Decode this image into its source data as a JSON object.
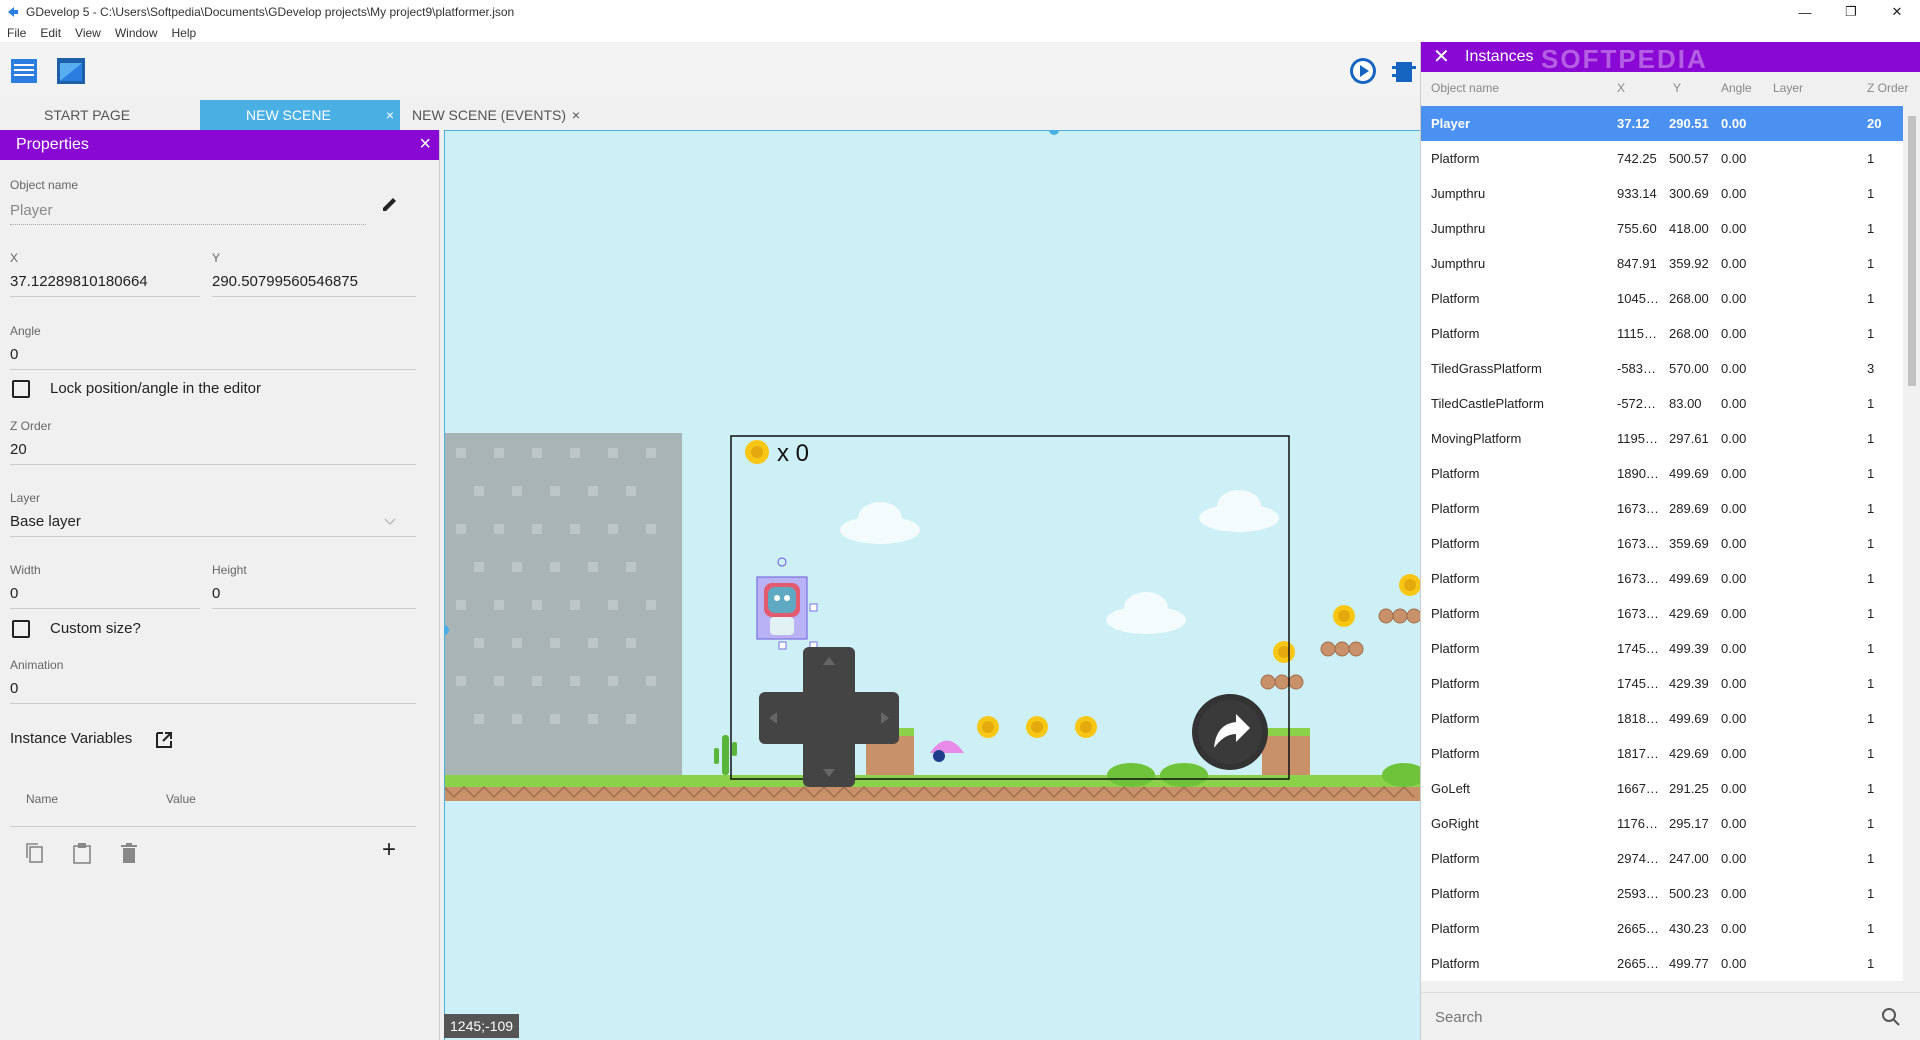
{
  "window": {
    "title": "GDevelop 5 - C:\\Users\\Softpedia\\Documents\\GDevelop projects\\My project9\\platformer.json",
    "controls": {
      "minimize": "—",
      "maximize": "❐",
      "close": "✕"
    }
  },
  "menu": [
    "File",
    "Edit",
    "View",
    "Window",
    "Help"
  ],
  "tabs": [
    {
      "label": "START PAGE",
      "active": false,
      "closable": false
    },
    {
      "label": "NEW SCENE",
      "active": true,
      "closable": true
    },
    {
      "label": "NEW SCENE (EVENTS)",
      "active": false,
      "closable": true
    }
  ],
  "tab_close_glyph": "×",
  "properties": {
    "title": "Properties",
    "close": "×",
    "object_name_label": "Object name",
    "object_name": "Player",
    "x_label": "X",
    "x_value": "37.12289810180664",
    "y_label": "Y",
    "y_value": "290.50799560546875",
    "angle_label": "Angle",
    "angle_value": "0",
    "lock_label": "Lock position/angle in the editor",
    "zorder_label": "Z Order",
    "zorder_value": "20",
    "layer_label": "Layer",
    "layer_value": "Base layer",
    "width_label": "Width",
    "width_value": "0",
    "height_label": "Height",
    "height_value": "0",
    "custom_size_label": "Custom size?",
    "animation_label": "Animation",
    "animation_value": "0",
    "instance_variables_label": "Instance Variables",
    "var_name_col": "Name",
    "var_value_col": "Value",
    "add_glyph": "+"
  },
  "scene": {
    "coin_counter": "x 0",
    "coordinate_readout": "1245;-109"
  },
  "instances": {
    "title": "Instances",
    "close": "✕",
    "watermark": "SOFTPEDIA",
    "columns": [
      "Object name",
      "X",
      "Y",
      "Angle",
      "Layer",
      "Z Order"
    ],
    "rows": [
      {
        "name": "Player",
        "x": "37.12",
        "y": "290.51",
        "angle": "0.00",
        "layer": "",
        "z": "20",
        "selected": true
      },
      {
        "name": "Platform",
        "x": "742.25",
        "y": "500.57",
        "angle": "0.00",
        "layer": "",
        "z": "1"
      },
      {
        "name": "Jumpthru",
        "x": "933.14",
        "y": "300.69",
        "angle": "0.00",
        "layer": "",
        "z": "1"
      },
      {
        "name": "Jumpthru",
        "x": "755.60",
        "y": "418.00",
        "angle": "0.00",
        "layer": "",
        "z": "1"
      },
      {
        "name": "Jumpthru",
        "x": "847.91",
        "y": "359.92",
        "angle": "0.00",
        "layer": "",
        "z": "1"
      },
      {
        "name": "Platform",
        "x": "1045…",
        "y": "268.00",
        "angle": "0.00",
        "layer": "",
        "z": "1"
      },
      {
        "name": "Platform",
        "x": "1115…",
        "y": "268.00",
        "angle": "0.00",
        "layer": "",
        "z": "1"
      },
      {
        "name": "TiledGrassPlatform",
        "x": "-583…",
        "y": "570.00",
        "angle": "0.00",
        "layer": "",
        "z": "3"
      },
      {
        "name": "TiledCastlePlatform",
        "x": "-572…",
        "y": "83.00",
        "angle": "0.00",
        "layer": "",
        "z": "1"
      },
      {
        "name": "MovingPlatform",
        "x": "1195…",
        "y": "297.61",
        "angle": "0.00",
        "layer": "",
        "z": "1"
      },
      {
        "name": "Platform",
        "x": "1890…",
        "y": "499.69",
        "angle": "0.00",
        "layer": "",
        "z": "1"
      },
      {
        "name": "Platform",
        "x": "1673…",
        "y": "289.69",
        "angle": "0.00",
        "layer": "",
        "z": "1"
      },
      {
        "name": "Platform",
        "x": "1673…",
        "y": "359.69",
        "angle": "0.00",
        "layer": "",
        "z": "1"
      },
      {
        "name": "Platform",
        "x": "1673…",
        "y": "499.69",
        "angle": "0.00",
        "layer": "",
        "z": "1"
      },
      {
        "name": "Platform",
        "x": "1673…",
        "y": "429.69",
        "angle": "0.00",
        "layer": "",
        "z": "1"
      },
      {
        "name": "Platform",
        "x": "1745…",
        "y": "499.39",
        "angle": "0.00",
        "layer": "",
        "z": "1"
      },
      {
        "name": "Platform",
        "x": "1745…",
        "y": "429.39",
        "angle": "0.00",
        "layer": "",
        "z": "1"
      },
      {
        "name": "Platform",
        "x": "1818…",
        "y": "499.69",
        "angle": "0.00",
        "layer": "",
        "z": "1"
      },
      {
        "name": "Platform",
        "x": "1817…",
        "y": "429.69",
        "angle": "0.00",
        "layer": "",
        "z": "1"
      },
      {
        "name": "GoLeft",
        "x": "1667…",
        "y": "291.25",
        "angle": "0.00",
        "layer": "",
        "z": "1"
      },
      {
        "name": "GoRight",
        "x": "1176…",
        "y": "295.17",
        "angle": "0.00",
        "layer": "",
        "z": "1"
      },
      {
        "name": "Platform",
        "x": "2974…",
        "y": "247.00",
        "angle": "0.00",
        "layer": "",
        "z": "1"
      },
      {
        "name": "Platform",
        "x": "2593…",
        "y": "500.23",
        "angle": "0.00",
        "layer": "",
        "z": "1"
      },
      {
        "name": "Platform",
        "x": "2665…",
        "y": "430.23",
        "angle": "0.00",
        "layer": "",
        "z": "1"
      },
      {
        "name": "Platform",
        "x": "2665…",
        "y": "499.77",
        "angle": "0.00",
        "layer": "",
        "z": "1"
      }
    ],
    "search_placeholder": "Search"
  },
  "colors": {
    "accent_purple": "#8a08d4",
    "tab_active": "#4ab0e4",
    "row_selected": "#4b91f1",
    "scene_bg": "#cdf0f6"
  }
}
